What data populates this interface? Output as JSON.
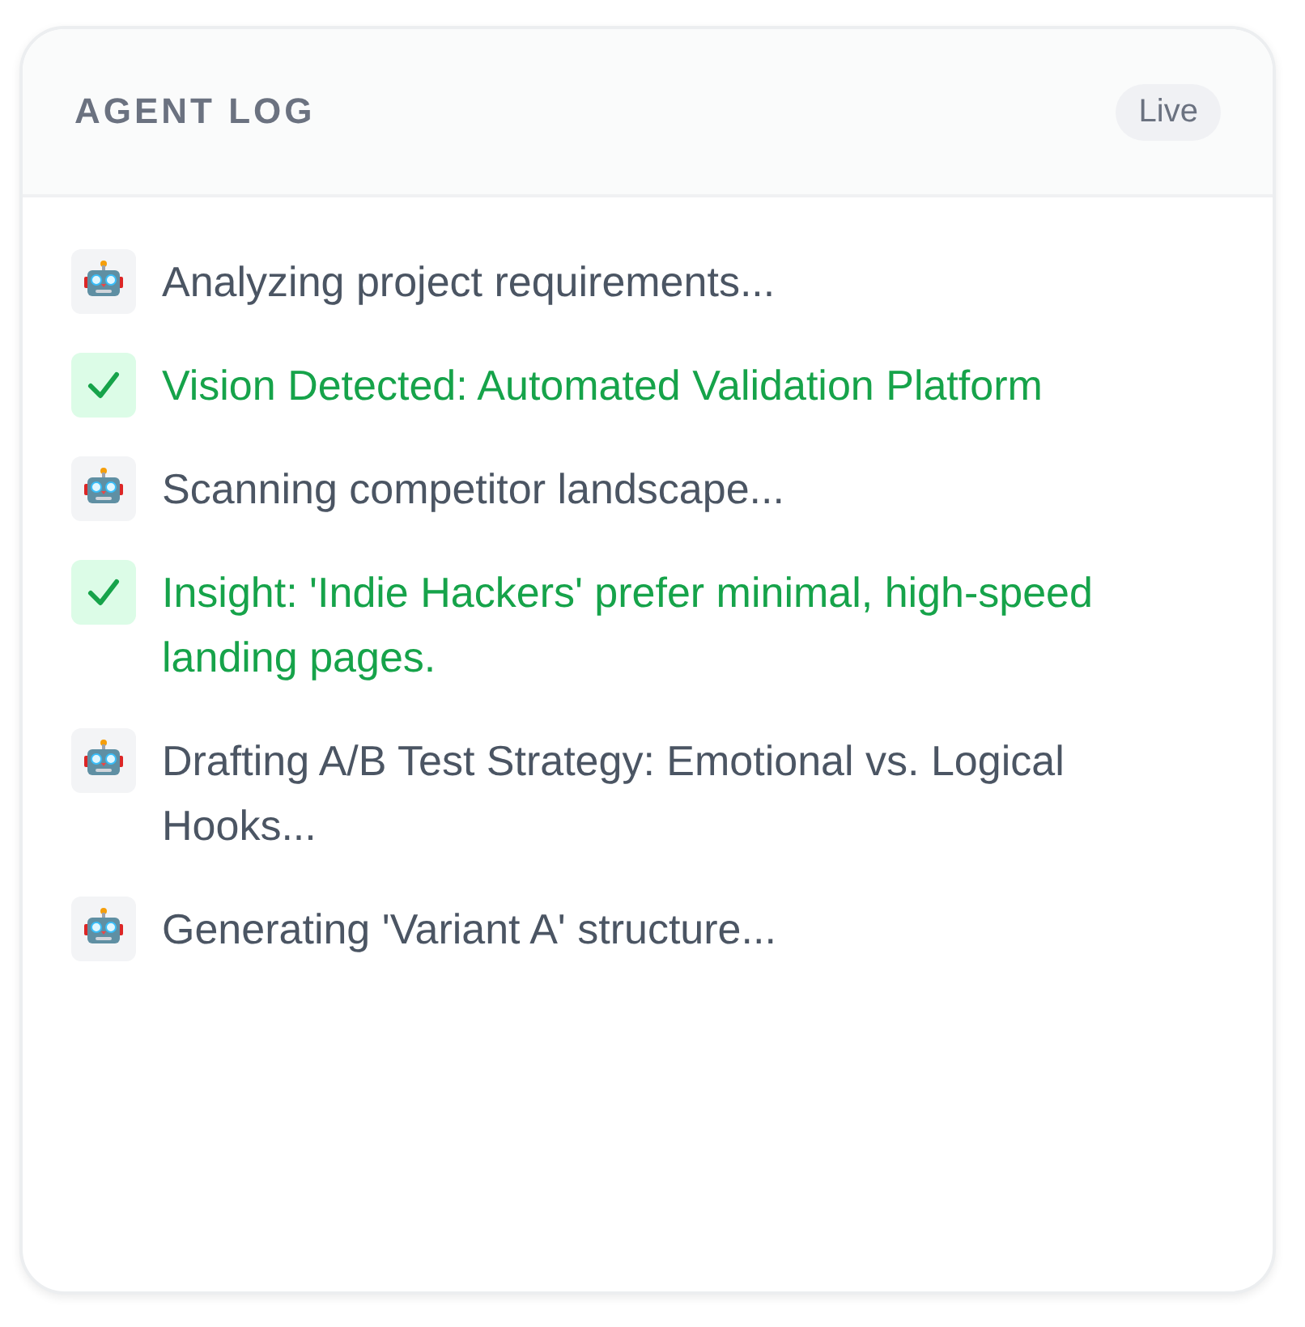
{
  "header": {
    "title": "AGENT LOG",
    "badge": "Live"
  },
  "entries": [
    {
      "kind": "progress",
      "text": "Analyzing project requirements..."
    },
    {
      "kind": "success",
      "text": "Vision Detected: Automated Validation Platform"
    },
    {
      "kind": "progress",
      "text": "Scanning competitor landscape..."
    },
    {
      "kind": "success",
      "text": "Insight: 'Indie Hackers' prefer minimal, high-speed landing pages."
    },
    {
      "kind": "progress",
      "text": "Drafting A/B Test Strategy: Emotional vs. Logical Hooks..."
    },
    {
      "kind": "progress",
      "text": "Generating 'Variant A' structure..."
    }
  ]
}
